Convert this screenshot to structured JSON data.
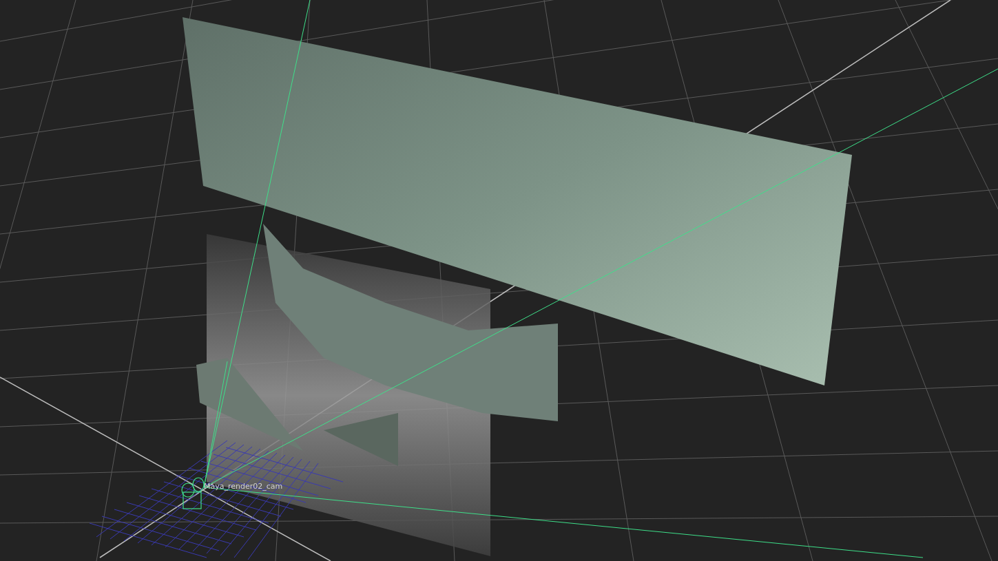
{
  "viewport": {
    "camera_label": "Maya_render02_cam"
  }
}
